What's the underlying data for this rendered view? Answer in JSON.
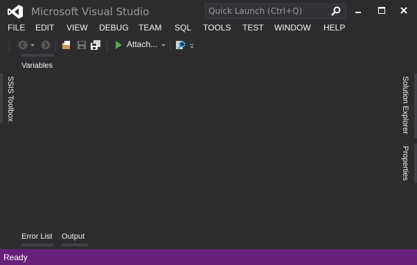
{
  "window": {
    "title": "Microsoft Visual Studio"
  },
  "quick_launch": {
    "placeholder": "Quick Launch (Ctrl+Q)"
  },
  "menu": [
    "FILE",
    "EDIT",
    "VIEW",
    "DEBUG",
    "TEAM",
    "SQL",
    "TOOLS",
    "TEST",
    "WINDOW",
    "HELP"
  ],
  "toolbar": {
    "attach_label": "Attach..."
  },
  "tool_windows": {
    "variables": "Variables",
    "ssis_toolbox": "SSIS Toolbox",
    "solution_explorer": "Solution Explorer",
    "properties": "Properties",
    "error_list": "Error List",
    "output": "Output"
  },
  "status": {
    "text": "Ready"
  },
  "colors": {
    "background": "#2d2d30",
    "status_bar": "#68217a",
    "logo": "#ffffff",
    "run": "#57a64a"
  },
  "icons": [
    "vs-logo-icon",
    "search-icon",
    "minimize-icon",
    "maximize-icon",
    "close-icon",
    "back-icon",
    "forward-icon",
    "open-folder-icon",
    "save-icon",
    "save-all-icon",
    "start-play-icon",
    "find-in-files-icon",
    "toolbar-overflow-icon"
  ]
}
